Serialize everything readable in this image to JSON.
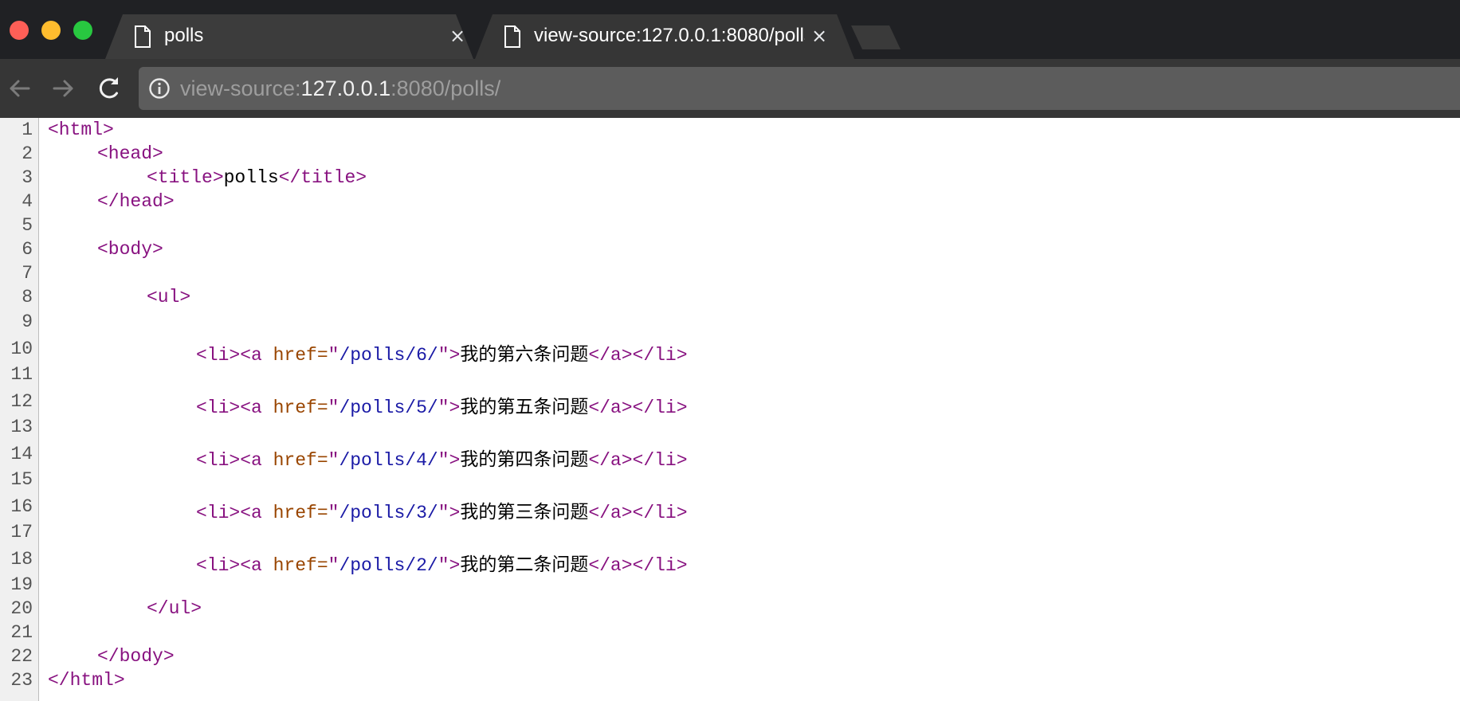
{
  "window": {
    "tabs": [
      {
        "title": "polls",
        "active": false
      },
      {
        "title": "view-source:127.0.0.1:8080/polls/",
        "active": true
      }
    ]
  },
  "toolbar": {
    "url_prefix": "view-source:",
    "url_host": "127.0.0.1",
    "url_rest": ":8080/polls/"
  },
  "source": {
    "line_numbers": [
      "1",
      "2",
      "3",
      "4",
      "5",
      "6",
      "7",
      "8",
      "9",
      "10",
      "11",
      "12",
      "13",
      "14",
      "15",
      "16",
      "17",
      "18",
      "19",
      "20",
      "21",
      "22",
      "23"
    ],
    "l1": {
      "tag": "<html>"
    },
    "l2": {
      "tag": "<head>"
    },
    "l3": {
      "open": "<title>",
      "text": "polls",
      "close": "</title>"
    },
    "l4": {
      "tag": "</head>"
    },
    "l6": {
      "tag": "<body>"
    },
    "l8": {
      "tag": "<ul>"
    },
    "items": [
      {
        "open": "<li><a ",
        "attr": "href=",
        "q1": "\"",
        "href": "/polls/6/",
        "q2": "\"",
        "gt": ">",
        "text": "我的第六条问题",
        "close": "</a></li>"
      },
      {
        "open": "<li><a ",
        "attr": "href=",
        "q1": "\"",
        "href": "/polls/5/",
        "q2": "\"",
        "gt": ">",
        "text": "我的第五条问题",
        "close": "</a></li>"
      },
      {
        "open": "<li><a ",
        "attr": "href=",
        "q1": "\"",
        "href": "/polls/4/",
        "q2": "\"",
        "gt": ">",
        "text": "我的第四条问题",
        "close": "</a></li>"
      },
      {
        "open": "<li><a ",
        "attr": "href=",
        "q1": "\"",
        "href": "/polls/3/",
        "q2": "\"",
        "gt": ">",
        "text": "我的第三条问题",
        "close": "</a></li>"
      },
      {
        "open": "<li><a ",
        "attr": "href=",
        "q1": "\"",
        "href": "/polls/2/",
        "q2": "\"",
        "gt": ">",
        "text": "我的第二条问题",
        "close": "</a></li>"
      }
    ],
    "l20": {
      "tag": "</ul>"
    },
    "l22": {
      "tag": "</body>"
    },
    "l23": {
      "tag": "</html>"
    }
  },
  "colors": {
    "tag": "#881280",
    "attribute": "#994500",
    "value": "#1a1aa6",
    "text": "#000000"
  }
}
